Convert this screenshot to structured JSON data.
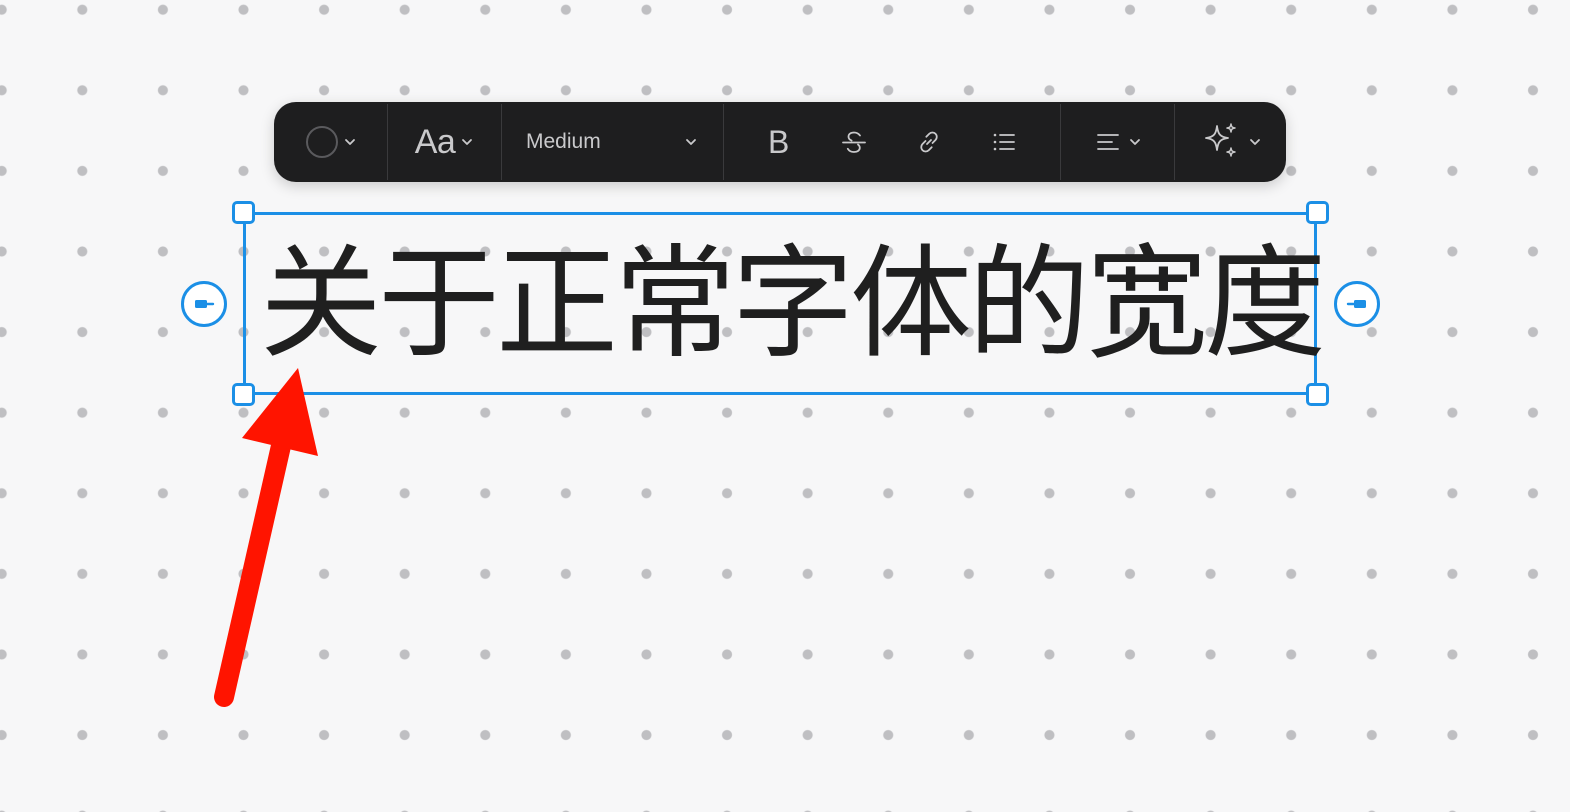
{
  "toolbar": {
    "color_picker": {
      "icon": "circle-outline-icon"
    },
    "font_family": {
      "label": "Aa"
    },
    "font_weight": {
      "label": "Medium"
    },
    "format_buttons": [
      {
        "name": "bold",
        "icon": "bold-icon",
        "glyph": "B"
      },
      {
        "name": "strikethrough",
        "icon": "strikethrough-icon"
      },
      {
        "name": "link",
        "icon": "link-icon"
      },
      {
        "name": "bulleted-list",
        "icon": "list-icon"
      }
    ],
    "align": {
      "icon": "align-left-icon"
    },
    "ai": {
      "icon": "sparkles-icon"
    }
  },
  "text_element": {
    "content": "关于正常字体的宽度"
  },
  "colors": {
    "canvas_background": "#f7f7f8",
    "grid_dot": "#bfbfc2",
    "toolbar_background": "#1e1e1f",
    "toolbar_foreground": "#d0d0d2",
    "selection_accent": "#1b8fe6",
    "text": "#1f1f1f",
    "annotation_arrow": "#ff1400"
  }
}
